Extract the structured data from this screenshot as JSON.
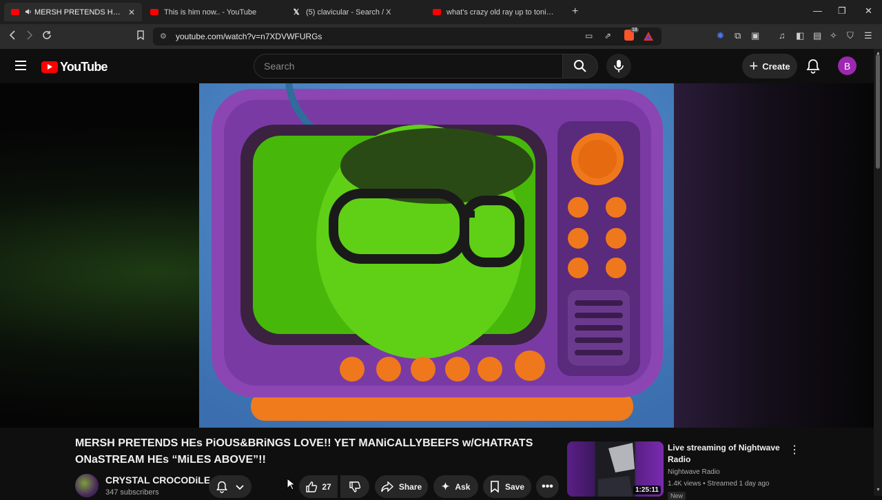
{
  "browser": {
    "tabs": [
      {
        "title": "MERSH PRETENDS HEs PiOUS",
        "favicon": "youtube-icon",
        "active": true,
        "audio": true
      },
      {
        "title": "This is him now.. - YouTube",
        "favicon": "youtube-icon",
        "active": false
      },
      {
        "title": "(5) clavicular - Search / X",
        "favicon": "x-icon",
        "active": false
      },
      {
        "title": "what's crazy old ray up to tonight? (g",
        "favicon": "youtube-icon",
        "active": false
      }
    ],
    "url": "youtube.com/watch?v=n7XDVWFURGs",
    "extension_badge": "18"
  },
  "youtube": {
    "logo_text": "YouTube",
    "search_placeholder": "Search",
    "create_label": "Create",
    "avatar_letter": "B"
  },
  "video": {
    "title": "MERSH PRETENDS HEs PiOUS&BRiNGS LOVE!! YET MANiCALLYBEEFS w/CHATRATS ONaSTREAM HEs “MiLES ABOVE”!!",
    "channel_name": "CRYSTAL CROCODiLE",
    "subscribers": "347 subscribers",
    "likes": "27",
    "share_label": "Share",
    "ask_label": "Ask",
    "save_label": "Save"
  },
  "recommended": [
    {
      "title": "Live streaming of Nightwave Radio",
      "channel": "Nightwave Radio",
      "meta": "1.4K views • Streamed 1 day ago",
      "duration": "1:25:11",
      "badge": "New"
    }
  ],
  "colors": {
    "youtube_red": "#ff0000",
    "avatar": "#9c27b0",
    "background": "#0f0f0f"
  }
}
